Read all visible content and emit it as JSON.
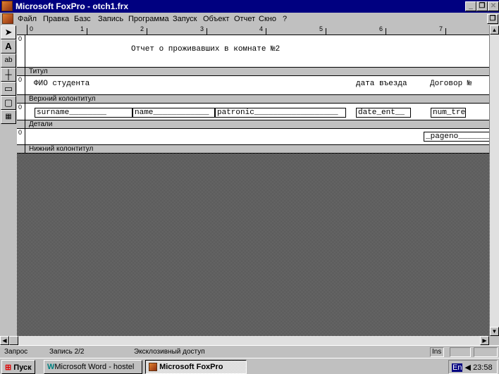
{
  "window": {
    "title": "Microsoft FoxPro - otch1.frx"
  },
  "menu": [
    "Файл",
    "Правка",
    "Базс",
    "Запись",
    "Программа",
    "Запуск",
    "Объект",
    "Отчет",
    "Скно",
    "?"
  ],
  "ruler": [
    "0",
    "1",
    "2",
    "3",
    "4",
    "5",
    "6",
    "7"
  ],
  "report": {
    "title_text": "Отчет о проживавших в комнате №2",
    "headers": [
      "ФИО студента",
      "дата въезда",
      "Договор №"
    ],
    "fields": [
      "surname________",
      "name____________",
      "patronic__________________",
      "date_ent__",
      "num_tre"
    ],
    "footer_field": "_pageno________",
    "bands": [
      "Титул",
      "Верхний колонтитул",
      "Детали",
      "Нижний колонтитул"
    ],
    "band_marker": "0"
  },
  "status": {
    "mode": "Запрос",
    "record": "Запись  2/2",
    "access": "Эксклозивный доступ",
    "ins": "Ins"
  },
  "taskbar": {
    "start": "Пуск",
    "items": [
      "Microsoft Word - hostel",
      "Microsoft FoxPro"
    ],
    "lang": "En",
    "time": "23:58"
  }
}
